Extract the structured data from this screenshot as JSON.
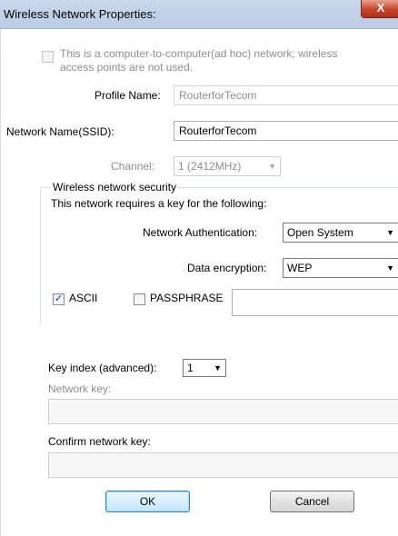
{
  "window": {
    "title": "Wireless Network Properties:",
    "close_label": "X"
  },
  "adhoc": {
    "checked": false,
    "line1": "This is a computer-to-computer(ad hoc) network; wireless",
    "line2": "access points are not used."
  },
  "profile": {
    "label": "Profile Name:",
    "value": "RouterforTecom"
  },
  "ssid": {
    "label": "Network Name(SSID):",
    "value": "RouterforTecom"
  },
  "channel": {
    "label": "Channel:",
    "value": "1  (2412MHz)"
  },
  "security": {
    "group_label": "Wireless network security",
    "requires_text": "This network requires a key for the following:",
    "auth_label": "Network Authentication:",
    "auth_value": "Open System",
    "encryption_label": "Data encryption:",
    "encryption_value": "WEP",
    "ascii_label": "ASCII",
    "ascii_checked": true,
    "passphrase_label": "PASSPHRASE",
    "passphrase_checked": false,
    "passphrase_value": ""
  },
  "key": {
    "index_label": "Key index (advanced):",
    "index_value": "1",
    "network_key_label": "Network key:",
    "network_key_value": "",
    "confirm_label": "Confirm network key:",
    "confirm_value": ""
  },
  "buttons": {
    "ok": "OK",
    "cancel": "Cancel"
  },
  "glyphs": {
    "check": "✓",
    "chevron": "▼"
  }
}
